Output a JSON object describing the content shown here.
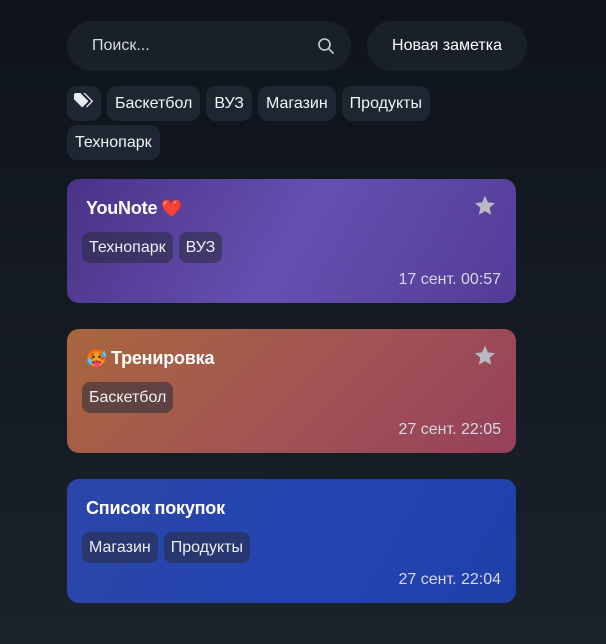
{
  "search": {
    "placeholder": "Поиск...",
    "icon": "search-icon"
  },
  "new_note_label": "Новая заметка",
  "tags": {
    "icon": "tags-icon",
    "items": [
      "Баскетбол",
      "ВУЗ",
      "Магазин",
      "Продукты",
      "Технопарк"
    ]
  },
  "notes": [
    {
      "title": "YouNote",
      "emoji": "❤️",
      "emoji_position": "after",
      "starred": true,
      "tags": [
        "Технопарк",
        "ВУЗ"
      ],
      "date": "17 сент. 00:57",
      "color": "#5a44a6"
    },
    {
      "title": "Тренировка",
      "emoji": "🥵",
      "emoji_position": "before",
      "starred": true,
      "tags": [
        "Баскетбол"
      ],
      "date": "27 сент. 22:05",
      "color": "#a35a4c"
    },
    {
      "title": "Список покупок",
      "emoji": "",
      "starred": false,
      "tags": [
        "Магазин",
        "Продукты"
      ],
      "date": "27 сент. 22:04",
      "color": "#2744ad"
    }
  ],
  "colors": {
    "background": "#151a22",
    "surface": "#1a2029",
    "star": "#b9b9c4"
  }
}
